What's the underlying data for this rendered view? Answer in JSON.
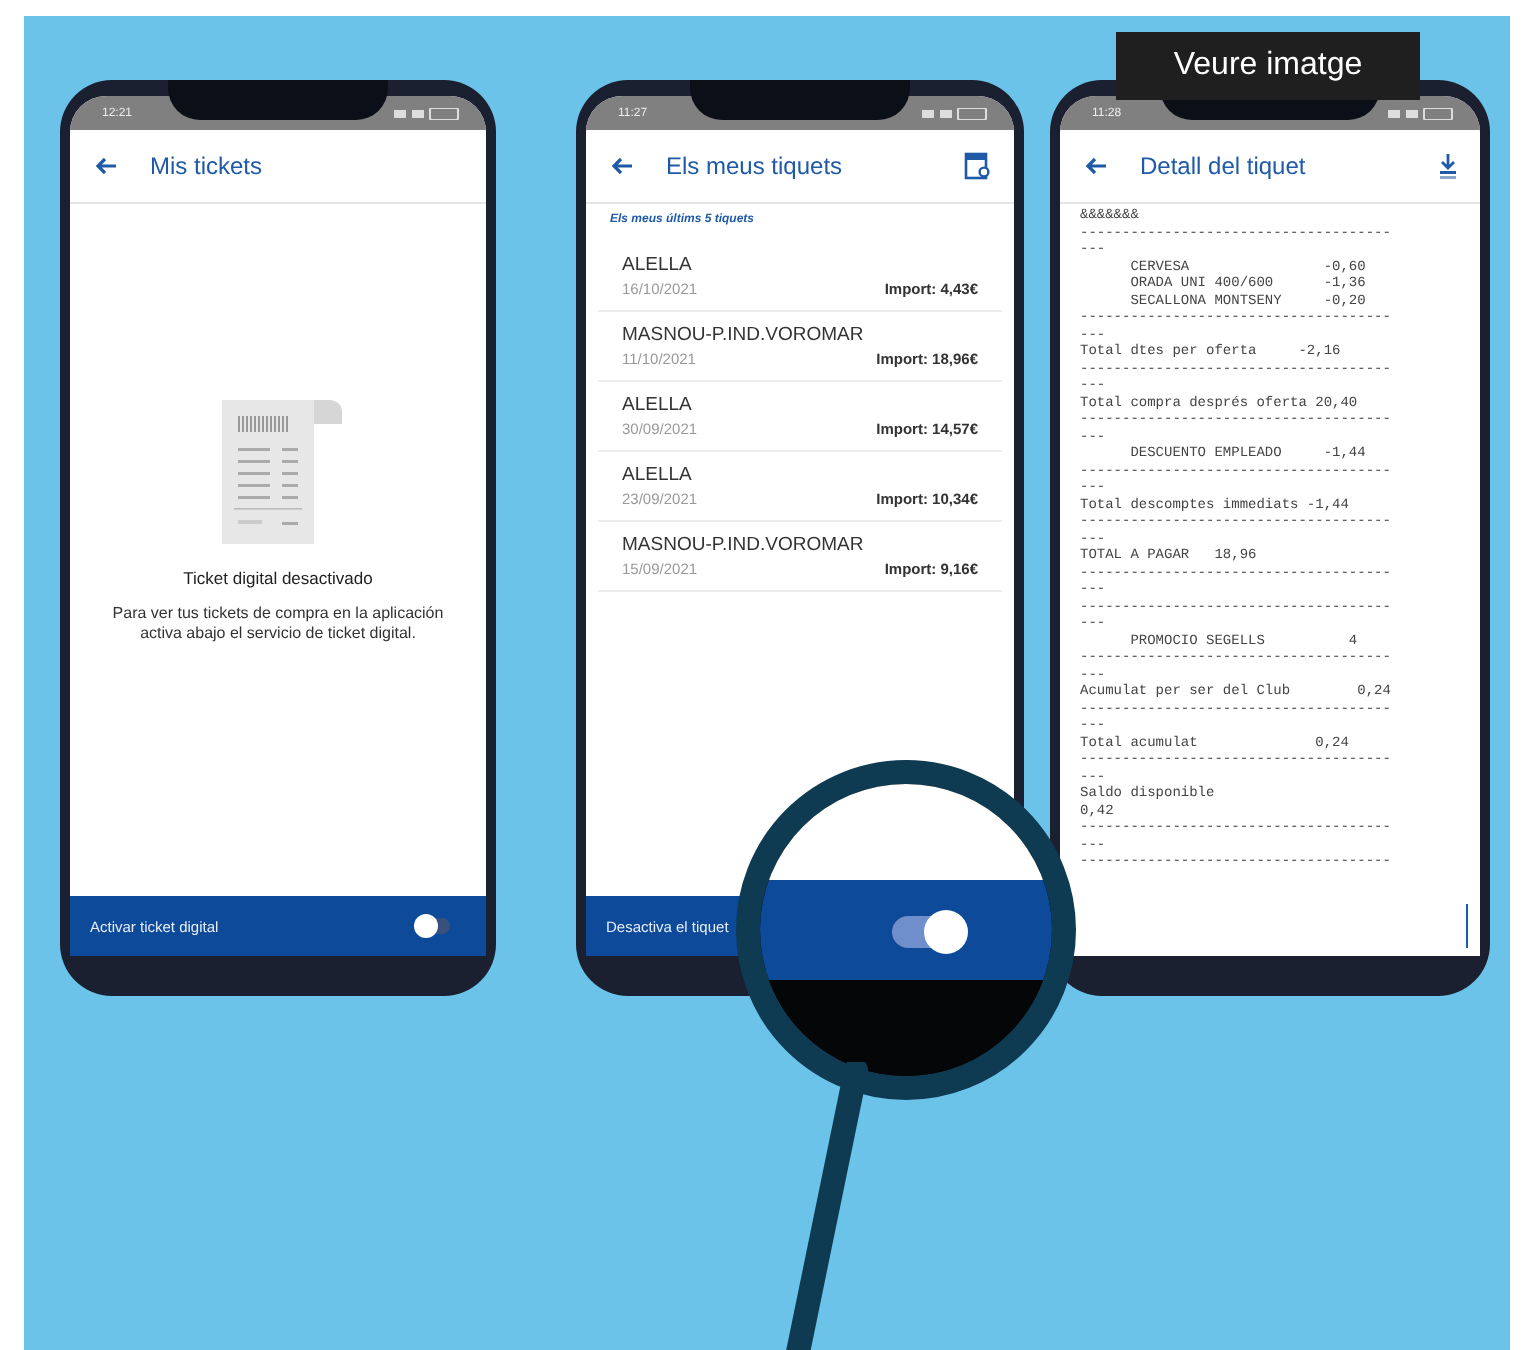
{
  "overlay_button": {
    "label": "Veure imatge"
  },
  "phones": [
    {
      "kind": "empty",
      "status_time": "12:21",
      "title": "Mis tickets",
      "empty_title": "Ticket digital desactivado",
      "empty_text": "Para ver tus tickets de compra en la aplicación activa abajo el servicio de ticket digital.",
      "bottom_bar": {
        "label": "Activar ticket digital",
        "on": false
      }
    },
    {
      "kind": "list",
      "status_time": "11:27",
      "title": "Els meus tiquets",
      "subtitle": "Els meus últims 5 tiquets",
      "tickets": [
        {
          "store": "ALELLA",
          "date": "16/10/2021",
          "amount": "Import: 4,43€"
        },
        {
          "store": "MASNOU-P.IND.VOROMAR",
          "date": "11/10/2021",
          "amount": "Import: 18,96€"
        },
        {
          "store": "ALELLA",
          "date": "30/09/2021",
          "amount": "Import: 14,57€"
        },
        {
          "store": "ALELLA",
          "date": "23/09/2021",
          "amount": "Import: 10,34€"
        },
        {
          "store": "MASNOU-P.IND.VOROMAR",
          "date": "15/09/2021",
          "amount": "Import: 9,16€"
        }
      ],
      "bottom_bar": {
        "label": "Desactiva el tiquet",
        "on": true
      }
    },
    {
      "kind": "receipt",
      "status_time": "11:28",
      "title": "Detall del tiquet",
      "receipt_lines": [
        "&&&&&&&",
        "-------------------------------------",
        "---",
        "      CERVESA                -0,60",
        "      ORADA UNI 400/600      -1,36",
        "      SECALLONA MONTSENY     -0,20",
        "-------------------------------------",
        "---",
        "Total dtes per oferta     -2,16",
        "-------------------------------------",
        "---",
        "Total compra després oferta 20,40",
        "-------------------------------------",
        "---",
        "      DESCUENTO EMPLEADO     -1,44",
        "-------------------------------------",
        "---",
        "Total descomptes immediats -1,44",
        "-------------------------------------",
        "---",
        "TOTAL A PAGAR   18,96",
        "-------------------------------------",
        "---",
        "-------------------------------------",
        "---",
        "      PROMOCIO SEGELLS          4",
        "-------------------------------------",
        "---",
        "Acumulat per ser del Club        0,24",
        "-------------------------------------",
        "---",
        "Total acumulat              0,24",
        "-------------------------------------",
        "---",
        "Saldo disponible",
        "0,42",
        "-------------------------------------",
        "---",
        "-------------------------------------"
      ]
    }
  ]
}
